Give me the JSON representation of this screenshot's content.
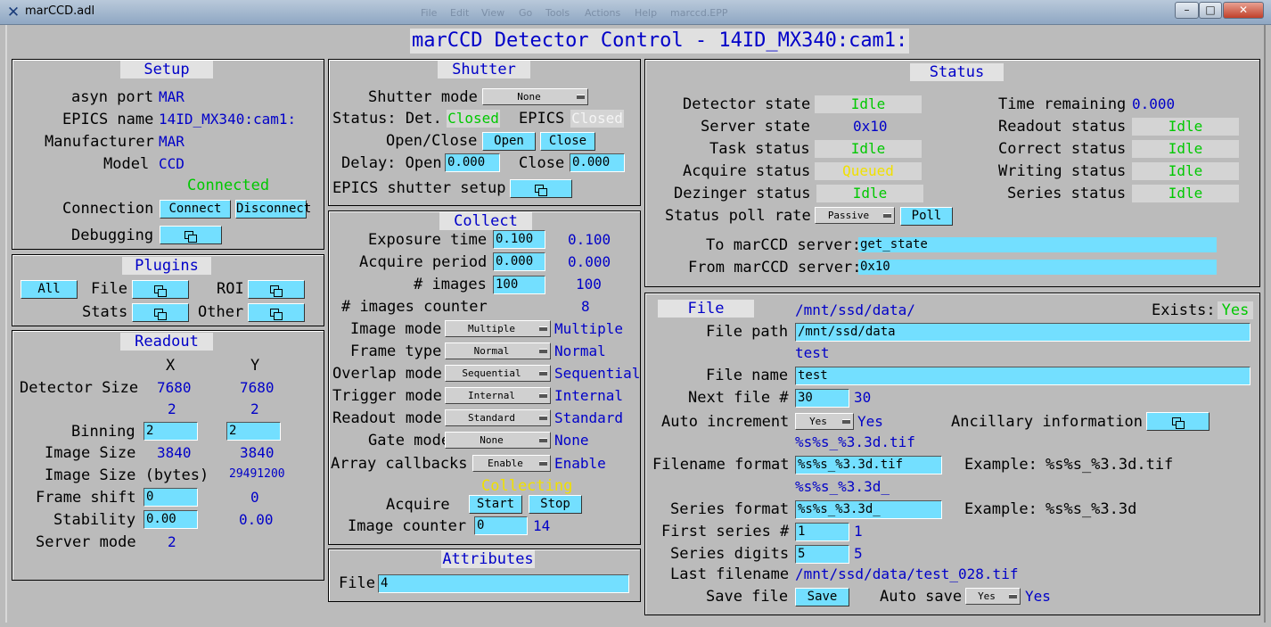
{
  "window": {
    "title": "marCCD.adl",
    "minimize": "–",
    "maximize": "□",
    "close": "✕",
    "ghost_menu": [
      "File",
      "Edit",
      "View",
      "Go",
      "Tools",
      "Actions",
      "Help",
      "marccd.EPP"
    ]
  },
  "heading": "marCCD Detector Control - 14ID_MX340:cam1:",
  "setup": {
    "title": "Setup",
    "asyn_port_label": "asyn port",
    "asyn_port": "MAR",
    "epics_name_label": "EPICS name",
    "epics_name": "14ID_MX340:cam1:",
    "manufacturer_label": "Manufacturer",
    "manufacturer": "MAR",
    "model_label": "Model",
    "model": "CCD",
    "connected": "Connected",
    "connection_label": "Connection",
    "connect": "Connect",
    "disconnect": "Disconnect",
    "debugging_label": "Debugging"
  },
  "plugins": {
    "title": "Plugins",
    "all": "All",
    "file": "File",
    "roi": "ROI",
    "stats": "Stats",
    "other": "Other"
  },
  "readout": {
    "title": "Readout",
    "x": "X",
    "y": "Y",
    "detector_size_label": "Detector Size",
    "detector_size_x": "7680",
    "detector_size_y": "7680",
    "binning_rbv_x": "2",
    "binning_rbv_y": "2",
    "binning_label": "Binning",
    "binning_x": "2",
    "binning_y": "2",
    "image_size_label": "Image Size",
    "image_size_x": "3840",
    "image_size_y": "3840",
    "image_bytes_label": "Image Size (bytes)",
    "image_bytes": "29491200",
    "frame_shift_label": "Frame shift",
    "frame_shift": "0",
    "frame_shift_rbv": "0",
    "stability_label": "Stability",
    "stability": "0.00",
    "stability_rbv": "0.00",
    "server_mode_label": "Server mode",
    "server_mode": "2"
  },
  "shutter": {
    "title": "Shutter",
    "mode_label": "Shutter mode",
    "mode": "None",
    "status_label": "Status: Det.",
    "det_status": "Closed",
    "epics_label": "EPICS",
    "epics_status": "Closed",
    "openclose_label": "Open/Close",
    "open": "Open",
    "close": "Close",
    "delay_label": "Delay: Open",
    "delay_open": "0.000",
    "close_label": "Close",
    "delay_close": "0.000",
    "setup_label": "EPICS shutter setup"
  },
  "collect": {
    "title": "Collect",
    "exposure_label": "Exposure time",
    "exposure": "0.100",
    "exposure_rbv": "0.100",
    "period_label": "Acquire period",
    "period": "0.000",
    "period_rbv": "0.000",
    "images_label": "# images",
    "images": "100",
    "images_rbv": "100",
    "counter_label": "# images counter",
    "counter": "8",
    "image_mode_label": "Image mode",
    "image_mode": "Multiple",
    "image_mode_rbv": "Multiple",
    "frame_type_label": "Frame type",
    "frame_type": "Normal",
    "frame_type_rbv": "Normal",
    "overlap_label": "Overlap mode",
    "overlap": "Sequential",
    "overlap_rbv": "Sequential",
    "trigger_label": "Trigger mode",
    "trigger": "Internal",
    "trigger_rbv": "Internal",
    "readout_mode_label": "Readout mode",
    "readout_mode": "Standard",
    "readout_mode_rbv": "Standard",
    "gate_label": "Gate mode",
    "gate": "None",
    "gate_rbv": "None",
    "callbacks_label": "Array callbacks",
    "callbacks": "Enable",
    "callbacks_rbv": "Enable",
    "collecting": "Collecting",
    "acquire_label": "Acquire",
    "start": "Start",
    "stop": "Stop",
    "image_counter_label": "Image counter",
    "image_counter": "0",
    "image_counter_rbv": "14"
  },
  "attributes": {
    "title": "Attributes",
    "file_label": "File",
    "file": "4"
  },
  "status": {
    "title": "Status",
    "detector_state_label": "Detector state",
    "detector_state": "Idle",
    "server_state_label": "Server state",
    "server_state": "0x10",
    "task_label": "Task status",
    "task": "Idle",
    "acquire_label": "Acquire status",
    "acquire": "Queued",
    "dezinger_label": "Dezinger status",
    "dezinger": "Idle",
    "poll_label": "Status poll rate",
    "poll_rate": "Passive",
    "poll": "Poll",
    "time_remaining_label": "Time remaining",
    "time_remaining": "0.000",
    "readout_label": "Readout status",
    "readout": "Idle",
    "correct_label": "Correct status",
    "correct": "Idle",
    "writing_label": "Writing status",
    "writing": "Idle",
    "series_label": "Series status",
    "series": "Idle",
    "to_label": "To marCCD server:",
    "to_server": "get_state",
    "from_label": "From marCCD server:",
    "from_server": "0x10"
  },
  "file": {
    "title": "File",
    "path_rbv": "/mnt/ssd/data/",
    "exists_label": "Exists:",
    "exists": "Yes",
    "path_label": "File path",
    "path": "/mnt/ssd/data",
    "name_rbv": "test",
    "name_label": "File name",
    "name": "test",
    "next_label": "Next file #",
    "next": "30",
    "next_rbv": "30",
    "auto_inc_label": "Auto increment",
    "auto_inc": "Yes",
    "auto_inc_rbv": "Yes",
    "ancillary_label": "Ancillary information",
    "format_rbv": "%s%s_%3.3d.tif",
    "format_label": "Filename format",
    "format": "%s%s_%3.3d.tif",
    "example_label": "Example:",
    "format_example": "%s%s_%3.3d.tif",
    "series_format_rbv": "%s%s_%3.3d_",
    "series_format_label": "Series format",
    "series_format": "%s%s_%3.3d_",
    "series_example": "%s%s_%3.3d",
    "first_series_label": "First series #",
    "first_series": "1",
    "first_series_rbv": "1",
    "series_digits_label": "Series digits",
    "series_digits": "5",
    "series_digits_rbv": "5",
    "last_label": "Last filename",
    "last": "/mnt/ssd/data/test_028.tif",
    "save_label": "Save file",
    "save": "Save",
    "auto_save_label": "Auto save",
    "auto_save": "Yes",
    "auto_save_rbv": "Yes"
  }
}
